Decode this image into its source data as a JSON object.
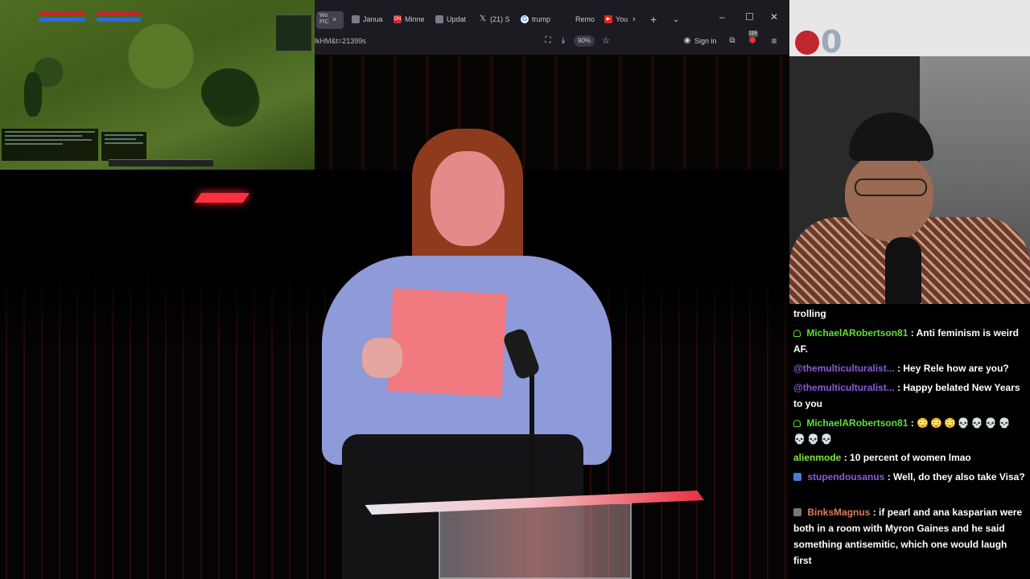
{
  "browser": {
    "tabs": [
      {
        "label": "Wo PIC",
        "favicon": "video-icon",
        "active": true
      },
      {
        "label": "Janua",
        "favicon": "doc-icon"
      },
      {
        "label": "Minne",
        "favicon": "news-icon",
        "fav_text": "ON",
        "fav_color": "#cc2b2b"
      },
      {
        "label": "Updat",
        "favicon": "doc-icon"
      },
      {
        "label": "(21) S",
        "favicon": "x-icon"
      },
      {
        "label": "trump",
        "favicon": "google-icon"
      },
      {
        "label": "Remo",
        "favicon": "blank-icon"
      },
      {
        "label": "You",
        "favicon": "youtube-icon",
        "fav_color": "#e62117"
      }
    ],
    "url_fragment": "lkHM&t=21399s",
    "zoom": "90%",
    "sign_in_label": "Sign in",
    "ext_badge": "115"
  },
  "webcam": {
    "badge_digit": "0"
  },
  "chat": {
    "messages": [
      {
        "user": "",
        "text": "trolling"
      },
      {
        "user": "MichaelARobertson81",
        "user_color": "#5ede3d",
        "badge": "green",
        "text": ": Anti feminism is weird AF."
      },
      {
        "user": "@themulticulturalist...",
        "user_color": "#8a5bd6",
        "text": ": Hey Rele how are you?"
      },
      {
        "user": "@themulticulturalist...",
        "user_color": "#8a5bd6",
        "text": ": Happy belated New Years to you"
      },
      {
        "user": "MichaelARobertson81",
        "user_color": "#5ede3d",
        "badge": "green",
        "text": ": ",
        "emotes": [
          "😳",
          "😳",
          "😳",
          "💀",
          "💀",
          "💀",
          "💀",
          "💀",
          "💀",
          "💀"
        ]
      },
      {
        "user": "alienmode",
        "user_color": "#7de83a",
        "text": ": 10 percent of women lmao"
      },
      {
        "user": "stupendousanus",
        "user_color": "#8a5bd6",
        "badge": "blue",
        "text": ": Well, do they also take Visa?"
      },
      {
        "user": "BinksMagnus",
        "user_color": "#e07a5f",
        "badge": "gray",
        "text": ": if pearl and ana kasparian were both in a room with Myron Gaines and he said something antisemitic, which one would laugh first"
      }
    ]
  },
  "colors": {
    "chrome_bg": "#1c1b22",
    "chat_bg": "#000000",
    "accent_red": "#c0262e"
  }
}
